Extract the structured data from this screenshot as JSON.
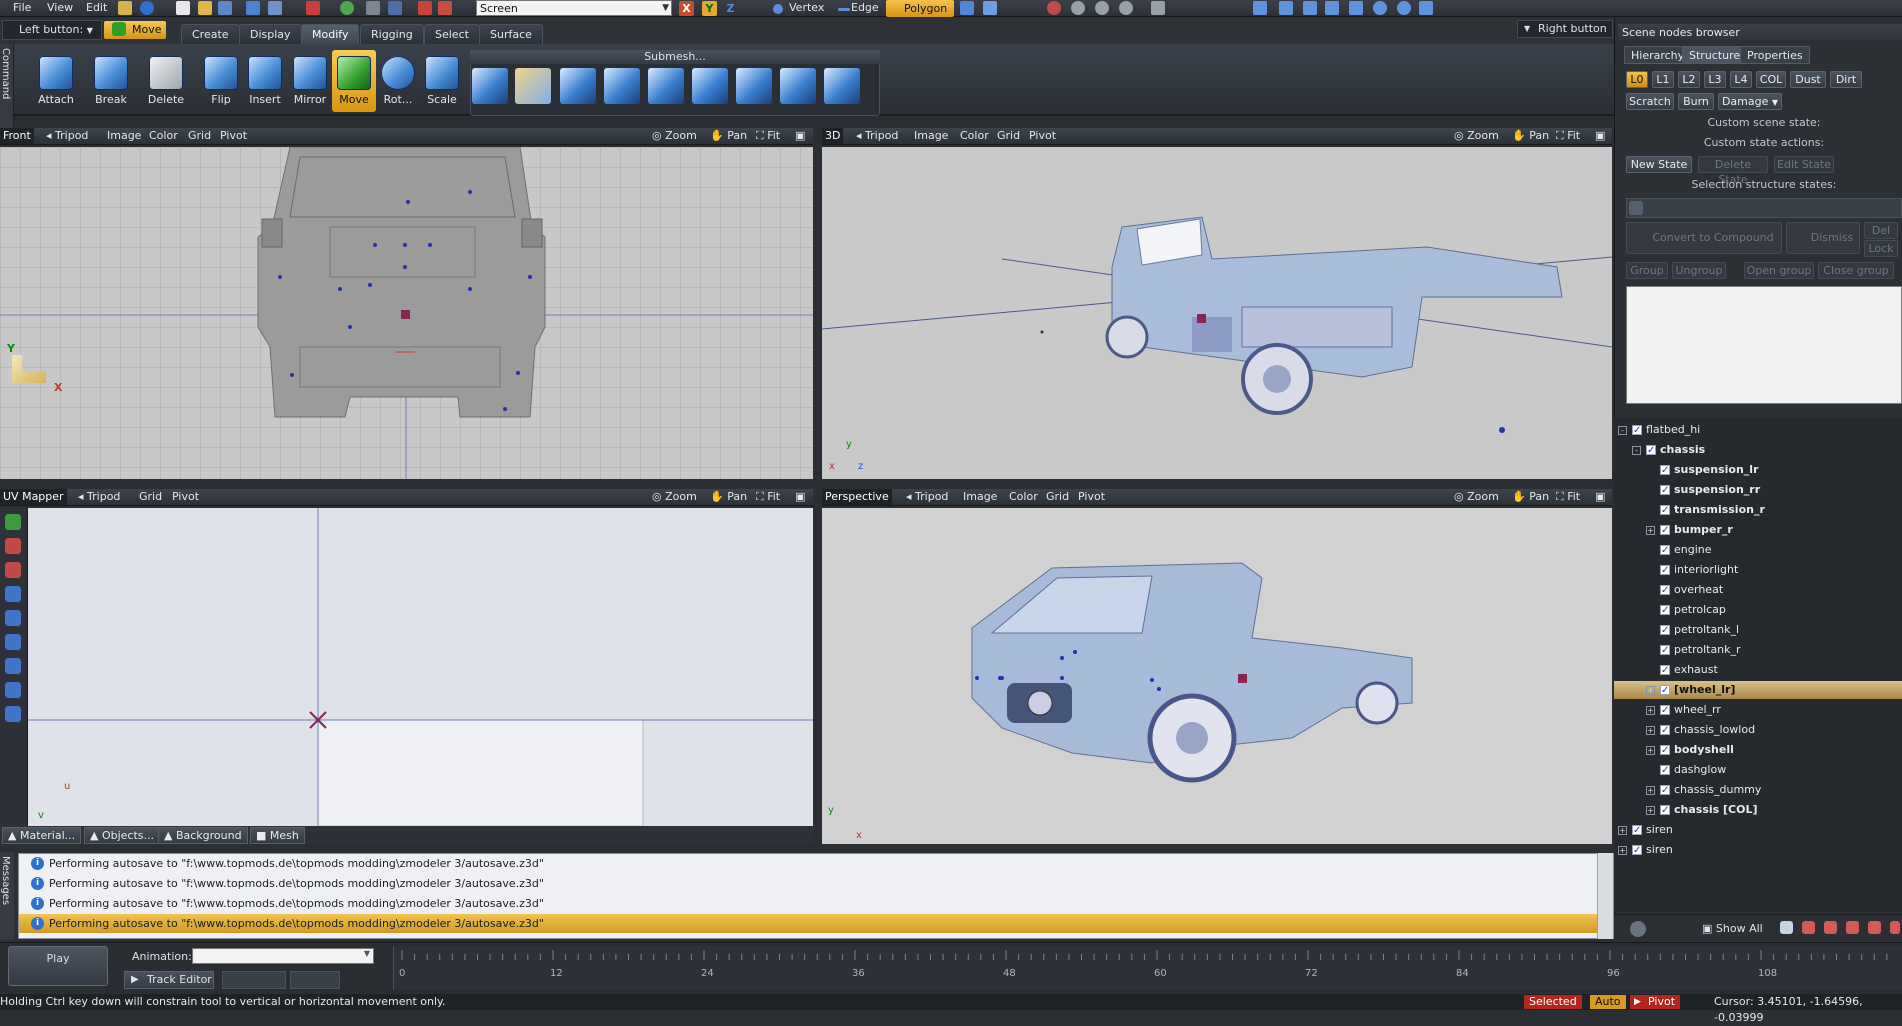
{
  "menu": {
    "file": "File",
    "view": "View",
    "edit": "Edit"
  },
  "toolbar": {
    "screen_select": "Screen",
    "vertex": "Vertex",
    "edge": "Edge",
    "polygon": "Polygon",
    "axis_x": "X",
    "axis_y": "Y",
    "axis_z": "Z"
  },
  "left_button": {
    "label": "Left button:",
    "mode": "Move"
  },
  "right_button": {
    "label": "Right button"
  },
  "tabs": [
    "Create",
    "Display",
    "Modify",
    "Rigging",
    "Select",
    "Surface"
  ],
  "active_tab": "Modify",
  "command_label": "Command",
  "ribbon": {
    "attach": "Attach",
    "break": "Break",
    "delete": "Delete",
    "flip": "Flip",
    "insert": "Insert",
    "mirror": "Mirror",
    "move": "Move",
    "rotate": "Rot...",
    "scale": "Scale",
    "submesh": "Submesh..."
  },
  "viewports": {
    "front": {
      "name": "Front",
      "tripod": "Tripod",
      "image": "Image",
      "color": "Color",
      "grid": "Grid",
      "pivot": "Pivot",
      "zoom": "Zoom",
      "pan": "Pan",
      "fit": "Fit",
      "axis_y": "Y",
      "axis_x": "X"
    },
    "three_d": {
      "name": "3D",
      "tripod": "Tripod",
      "image": "Image",
      "color": "Color",
      "grid": "Grid",
      "pivot": "Pivot",
      "zoom": "Zoom",
      "pan": "Pan",
      "fit": "Fit",
      "axis_y": "y",
      "axis_x": "x",
      "axis_z": "z"
    },
    "uv": {
      "name": "UV Mapper",
      "tripod": "Tripod",
      "grid": "Grid",
      "pivot": "Pivot",
      "zoom": "Zoom",
      "pan": "Pan",
      "fit": "Fit",
      "axis_u": "u",
      "axis_v": "v"
    },
    "perspective": {
      "name": "Perspective",
      "tripod": "Tripod",
      "image": "Image",
      "color": "Color",
      "grid": "Grid",
      "pivot": "Pivot",
      "zoom": "Zoom",
      "pan": "Pan",
      "fit": "Fit",
      "axis_y": "y",
      "axis_x": "x"
    }
  },
  "bottom_tabs": {
    "material": "Material...",
    "objects": "Objects...",
    "background": "Background",
    "mesh": "Mesh"
  },
  "scene_browser": {
    "title": "Scene nodes browser",
    "tabs": [
      "Hierarchy",
      "Structure",
      "Properties"
    ],
    "lod": [
      "L0",
      "L1",
      "L2",
      "L3",
      "L4",
      "COL",
      "Dust",
      "Dirt"
    ],
    "state_btns": [
      "Scratch",
      "Burn",
      "Damage"
    ],
    "custom_scene_state": "Custom scene state:",
    "custom_state_actions": "Custom state actions:",
    "new_state": "New State",
    "delete_state": "Delete State",
    "edit_state": "Edit State",
    "selection_structure_states": "Selection structure states:",
    "convert": "Convert to Compound",
    "dismiss": "Dismiss",
    "del": "Del",
    "lock": "Lock",
    "group": "Group",
    "ungroup": "Ungroup",
    "open_group": "Open group",
    "close_group": "Close group",
    "show_all": "Show All"
  },
  "tree": [
    {
      "label": "flatbed_hi",
      "level": 0,
      "expand": "-",
      "bold": false
    },
    {
      "label": "chassis",
      "level": 1,
      "expand": "-",
      "bold": true
    },
    {
      "label": "suspension_lr",
      "level": 2,
      "expand": "",
      "bold": true
    },
    {
      "label": "suspension_rr",
      "level": 2,
      "expand": "",
      "bold": true
    },
    {
      "label": "transmission_r",
      "level": 2,
      "expand": "",
      "bold": true
    },
    {
      "label": "bumper_r",
      "level": 2,
      "expand": "+",
      "bold": true
    },
    {
      "label": "engine",
      "level": 2,
      "expand": "",
      "bold": false
    },
    {
      "label": "interiorlight",
      "level": 2,
      "expand": "",
      "bold": false
    },
    {
      "label": "overheat",
      "level": 2,
      "expand": "",
      "bold": false
    },
    {
      "label": "petrolcap",
      "level": 2,
      "expand": "",
      "bold": false
    },
    {
      "label": "petroltank_l",
      "level": 2,
      "expand": "",
      "bold": false
    },
    {
      "label": "petroltank_r",
      "level": 2,
      "expand": "",
      "bold": false
    },
    {
      "label": "exhaust",
      "level": 2,
      "expand": "",
      "bold": false
    },
    {
      "label": "[wheel_lr]",
      "level": 2,
      "expand": "+",
      "bold": true,
      "highlight": true
    },
    {
      "label": "wheel_rr",
      "level": 2,
      "expand": "+",
      "bold": false
    },
    {
      "label": "chassis_lowlod",
      "level": 2,
      "expand": "+",
      "bold": false
    },
    {
      "label": "bodyshell",
      "level": 2,
      "expand": "+",
      "bold": true
    },
    {
      "label": "dashglow",
      "level": 2,
      "expand": "",
      "bold": false
    },
    {
      "label": "chassis_dummy",
      "level": 2,
      "expand": "+",
      "bold": false
    },
    {
      "label": "chassis [COL]",
      "level": 2,
      "expand": "+",
      "bold": true
    },
    {
      "label": "siren",
      "level": 0,
      "expand": "+",
      "bold": false
    },
    {
      "label": "siren",
      "level": 0,
      "expand": "+",
      "bold": false
    }
  ],
  "messages": {
    "label": "Messages",
    "items": [
      "Performing autosave to \"f:\\www.topmods.de\\topmods modding\\zmodeler 3/autosave.z3d\"",
      "Performing autosave to \"f:\\www.topmods.de\\topmods modding\\zmodeler 3/autosave.z3d\"",
      "Performing autosave to \"f:\\www.topmods.de\\topmods modding\\zmodeler 3/autosave.z3d\"",
      "Performing autosave to \"f:\\www.topmods.de\\topmods modding\\zmodeler 3/autosave.z3d\""
    ]
  },
  "timeline": {
    "play": "Play",
    "animation_label": "Animation:",
    "track_editor": "Track Editor",
    "ticks": [
      "0",
      "12",
      "24",
      "36",
      "48",
      "60",
      "72",
      "84",
      "96",
      "108"
    ]
  },
  "status": {
    "hint": "Holding Ctrl key down will constrain tool to vertical or horizontal movement only.",
    "selected": "Selected",
    "auto": "Auto",
    "pivot": "Pivot",
    "cursor": "Cursor: 3.45101, -1.64596, -0.03999"
  },
  "colors": {
    "accent": "#e0a62a",
    "selected_status": "#c62828",
    "viewport_bg": "#c9c9c9"
  }
}
